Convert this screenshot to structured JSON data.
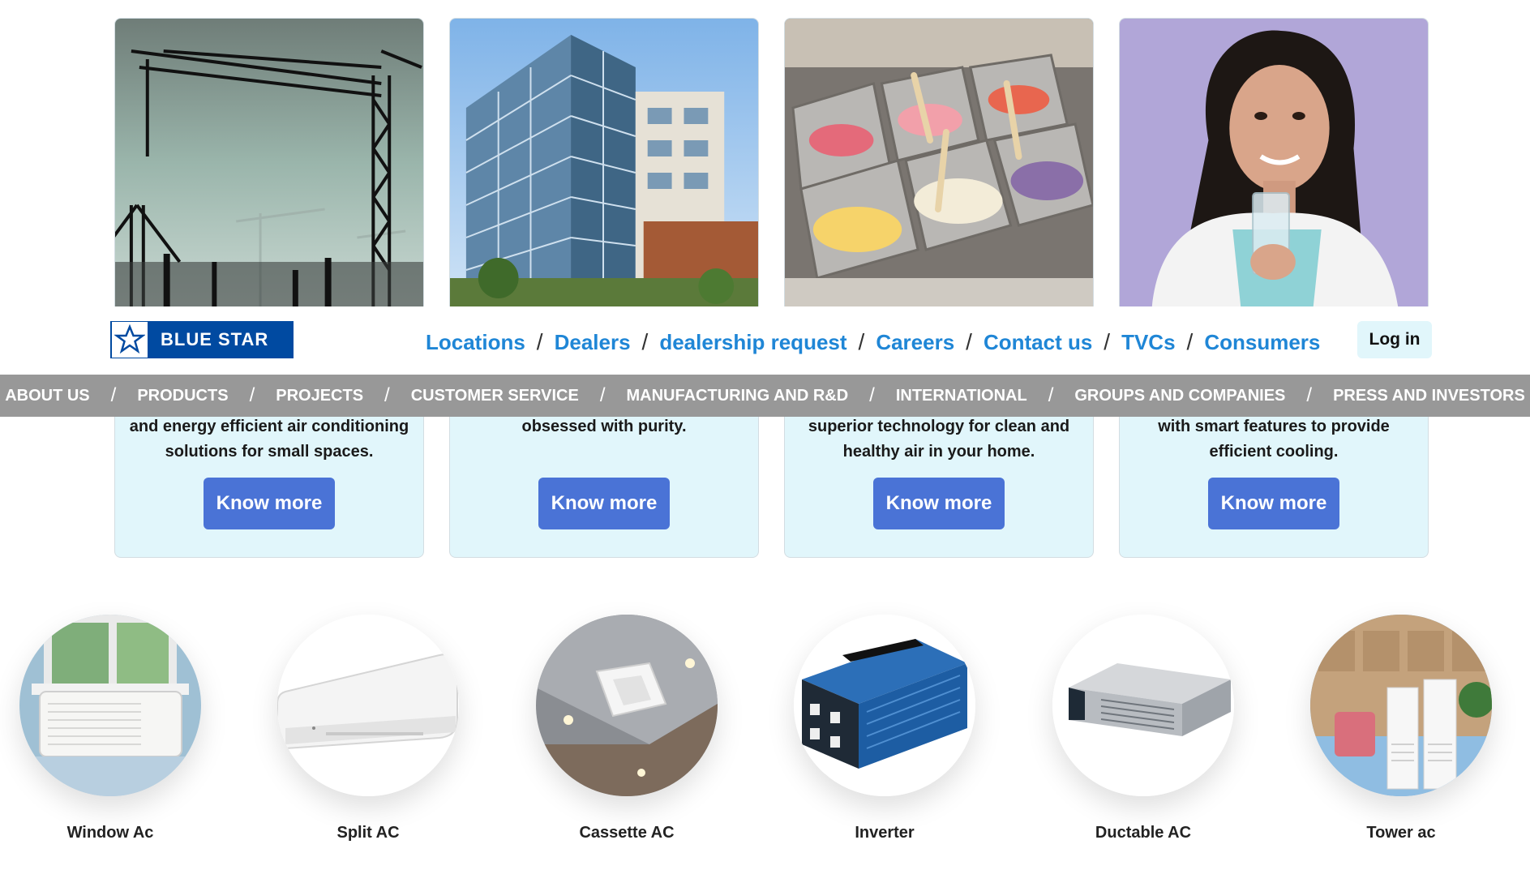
{
  "header": {
    "logo_text": "BLUE STAR",
    "links": [
      "Locations",
      "Dealers",
      "dealership request",
      "Careers",
      "Contact us",
      "TVCs",
      "Consumers"
    ],
    "separator": "/",
    "login_label": "Log in"
  },
  "main_nav": {
    "items": [
      "ABOUT US",
      "PRODUCTS",
      "PROJECTS",
      "CUSTOMER SERVICE",
      "MANUFACTURING AND R&D",
      "INTERNATIONAL",
      "GROUPS AND COMPANIES",
      "PRESS AND INVESTORS"
    ]
  },
  "cards": [
    {
      "image": "construction-cranes",
      "desc_line1": "and energy efficient air conditioning",
      "desc_line2": "solutions for small spaces.",
      "button_label": "Know more"
    },
    {
      "image": "glass-office-building",
      "desc_line1": "obsessed with purity.",
      "desc_line2": "",
      "button_label": "Know more"
    },
    {
      "image": "ice-cream-display-freezer",
      "desc_line1": "superior technology for clean and",
      "desc_line2": "healthy air in your home.",
      "button_label": "Know more"
    },
    {
      "image": "woman-holding-water-glass",
      "desc_line1": "with smart features to provide",
      "desc_line2": "efficient cooling.",
      "button_label": "Know more"
    }
  ],
  "categories": [
    {
      "label": "Window Ac",
      "image": "window-ac"
    },
    {
      "label": "Split AC",
      "image": "split-ac"
    },
    {
      "label": "Cassette AC",
      "image": "cassette-ac"
    },
    {
      "label": "Inverter",
      "image": "inverter"
    },
    {
      "label": "Ductable AC",
      "image": "ductable-ac"
    },
    {
      "label": "Tower ac",
      "image": "tower-ac"
    }
  ],
  "colors": {
    "brand_blue": "#004aa1",
    "link_blue": "#1f86d6",
    "button_blue": "#4a73d6",
    "card_bg": "#e1f6fb",
    "nav_bg": "#989898"
  }
}
